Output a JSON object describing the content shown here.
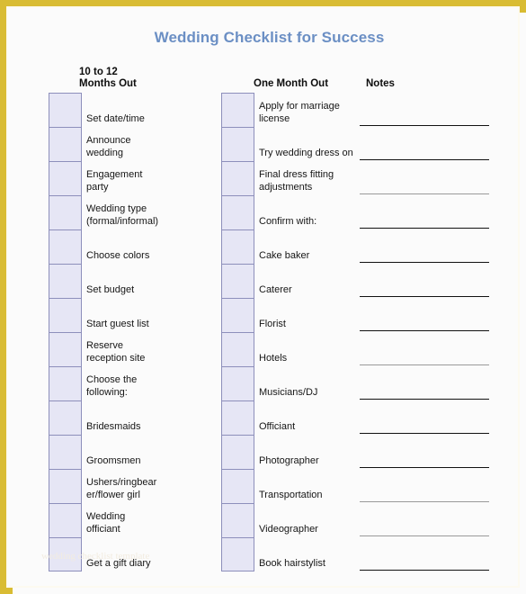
{
  "document": {
    "title": "Wedding Checklist for Success",
    "title_color": "#6b8fc4",
    "frame_color": "#d9bc33",
    "page_background": "#fbfbfb",
    "checkbox_fill": "#e6e6f5",
    "checkbox_border": "#8d8fbb",
    "watermark": "wedding checklist template"
  },
  "headers": {
    "left_column": "10 to 12\nMonths Out",
    "right_column": "One Month Out",
    "notes_column": "Notes"
  },
  "columns": {
    "left": {
      "heading": "10 to 12 Months Out",
      "items": [
        "Set date/time",
        "Announce\nwedding",
        "Engagement\nparty",
        "Wedding type\n(formal/informal)",
        "Choose colors",
        "Set budget",
        "Start guest list",
        "Reserve\nreception site",
        "Choose the\nfollowing:",
        "Bridesmaids",
        "Groomsmen",
        "Ushers/ringbear\ner/flower girl",
        "Wedding\nofficiant",
        "Get a gift diary"
      ]
    },
    "right": {
      "heading": "One Month Out",
      "items": [
        "Apply for marriage\nlicense",
        "Try wedding dress on",
        "Final dress fitting\nadjustments",
        "Confirm with:",
        "Cake baker",
        "Caterer",
        "Florist",
        "Hotels",
        "Musicians/DJ",
        "Officiant",
        "Photographer",
        "Transportation",
        "Videographer",
        "Book hairstylist"
      ]
    }
  },
  "notes": {
    "heading": "Notes",
    "lines": [
      {
        "row": 1,
        "style": "solid"
      },
      {
        "row": 2,
        "style": "solid"
      },
      {
        "row": 3,
        "style": "faint"
      },
      {
        "row": 4,
        "style": "solid"
      },
      {
        "row": 5,
        "style": "solid"
      },
      {
        "row": 6,
        "style": "solid"
      },
      {
        "row": 7,
        "style": "solid"
      },
      {
        "row": 8,
        "style": "faint"
      },
      {
        "row": 9,
        "style": "solid"
      },
      {
        "row": 10,
        "style": "solid"
      },
      {
        "row": 11,
        "style": "solid"
      },
      {
        "row": 12,
        "style": "faint"
      },
      {
        "row": 13,
        "style": "faint"
      },
      {
        "row": 14,
        "style": "solid"
      }
    ]
  }
}
